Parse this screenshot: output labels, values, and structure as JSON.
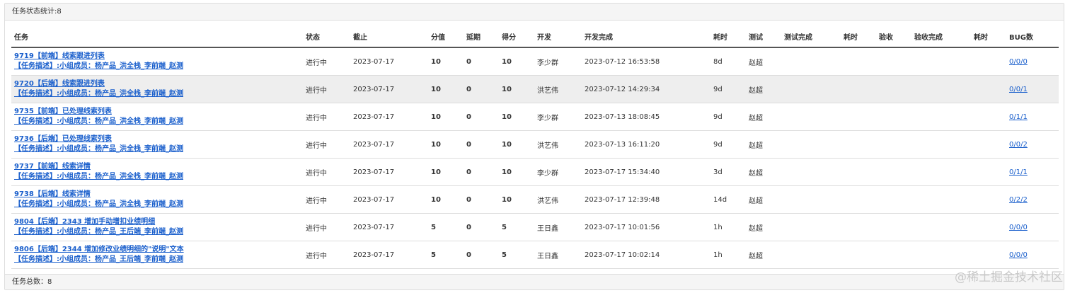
{
  "header": {
    "title": "任务状态统计:8"
  },
  "columns": [
    "任务",
    "状态",
    "截止",
    "分值",
    "延期",
    "得分",
    "开发",
    "开发完成",
    "耗时",
    "测试",
    "测试完成",
    "耗时",
    "验收",
    "验收完成",
    "耗时",
    "BUG数"
  ],
  "rows": [
    {
      "title": "9719【前端】线索跟进列表",
      "desc": "【任务描述】:小组成员：杨产品_洪全栈_李前端_赵测",
      "status": "进行中",
      "deadline": "2023-07-17",
      "points": "10",
      "delay": "0",
      "score": "10",
      "dev": "李少群",
      "dev_done": "2023-07-12 16:53:58",
      "dev_time": "8d",
      "tester": "赵超",
      "test_done": "",
      "test_time": "",
      "accept": "",
      "accept_done": "",
      "accept_time": "",
      "bugs": "0/0/0"
    },
    {
      "title": "9720【后端】线索跟进列表",
      "desc": "【任务描述】:小组成员：杨产品_洪全栈_李前端_赵测",
      "status": "进行中",
      "deadline": "2023-07-17",
      "points": "10",
      "delay": "0",
      "score": "10",
      "dev": "洪艺伟",
      "dev_done": "2023-07-12 14:29:34",
      "dev_time": "9d",
      "tester": "赵超",
      "test_done": "",
      "test_time": "",
      "accept": "",
      "accept_done": "",
      "accept_time": "",
      "bugs": "0/0/1"
    },
    {
      "title": "9735【前端】已处理线索列表",
      "desc": "【任务描述】:小组成员：杨产品_洪全栈_李前端_赵测",
      "status": "进行中",
      "deadline": "2023-07-17",
      "points": "10",
      "delay": "0",
      "score": "10",
      "dev": "李少群",
      "dev_done": "2023-07-13 18:08:45",
      "dev_time": "9d",
      "tester": "赵超",
      "test_done": "",
      "test_time": "",
      "accept": "",
      "accept_done": "",
      "accept_time": "",
      "bugs": "0/1/1"
    },
    {
      "title": "9736【后端】已处理线索列表",
      "desc": "【任务描述】:小组成员：杨产品_洪全栈_李前端_赵测",
      "status": "进行中",
      "deadline": "2023-07-17",
      "points": "10",
      "delay": "0",
      "score": "10",
      "dev": "洪艺伟",
      "dev_done": "2023-07-13 16:11:20",
      "dev_time": "9d",
      "tester": "赵超",
      "test_done": "",
      "test_time": "",
      "accept": "",
      "accept_done": "",
      "accept_time": "",
      "bugs": "0/0/2"
    },
    {
      "title": "9737【前端】线索详情",
      "desc": "【任务描述】:小组成员：杨产品_洪全栈_李前端_赵测",
      "status": "进行中",
      "deadline": "2023-07-17",
      "points": "10",
      "delay": "0",
      "score": "10",
      "dev": "李少群",
      "dev_done": "2023-07-17 15:34:40",
      "dev_time": "3d",
      "tester": "赵超",
      "test_done": "",
      "test_time": "",
      "accept": "",
      "accept_done": "",
      "accept_time": "",
      "bugs": "0/1/1"
    },
    {
      "title": "9738【后端】线索详情",
      "desc": "【任务描述】:小组成员：杨产品_洪全栈_李前端_赵测",
      "status": "进行中",
      "deadline": "2023-07-17",
      "points": "10",
      "delay": "0",
      "score": "10",
      "dev": "洪艺伟",
      "dev_done": "2023-07-17 12:39:48",
      "dev_time": "14d",
      "tester": "赵超",
      "test_done": "",
      "test_time": "",
      "accept": "",
      "accept_done": "",
      "accept_time": "",
      "bugs": "0/2/2"
    },
    {
      "title": "9804【后端】2343 增加手动增扣业绩明细",
      "desc": "【任务描述】:小组成员：杨产品_王后端_李前端_赵测",
      "status": "进行中",
      "deadline": "2023-07-17",
      "points": "5",
      "delay": "0",
      "score": "5",
      "dev": "王日鑫",
      "dev_done": "2023-07-17 10:01:56",
      "dev_time": "1h",
      "tester": "赵超",
      "test_done": "",
      "test_time": "",
      "accept": "",
      "accept_done": "",
      "accept_time": "",
      "bugs": "0/0/0"
    },
    {
      "title": "9806【后端】2344 增加修改业绩明细的\"说明\"文本",
      "desc": "【任务描述】:小组成员：杨产品_王后端_李前端_赵测",
      "status": "进行中",
      "deadline": "2023-07-17",
      "points": "5",
      "delay": "0",
      "score": "5",
      "dev": "王日鑫",
      "dev_done": "2023-07-17 10:02:14",
      "dev_time": "1h",
      "tester": "赵超",
      "test_done": "",
      "test_time": "",
      "accept": "",
      "accept_done": "",
      "accept_time": "",
      "bugs": "0/0/0"
    }
  ],
  "footer": {
    "total": "任务总数：8"
  },
  "watermark": "@稀土掘金技术社区",
  "colors": {
    "link": "#1a5fcc",
    "row_highlight": "#eeeeee",
    "border": "#dddddd",
    "header_rule": "#555555"
  }
}
